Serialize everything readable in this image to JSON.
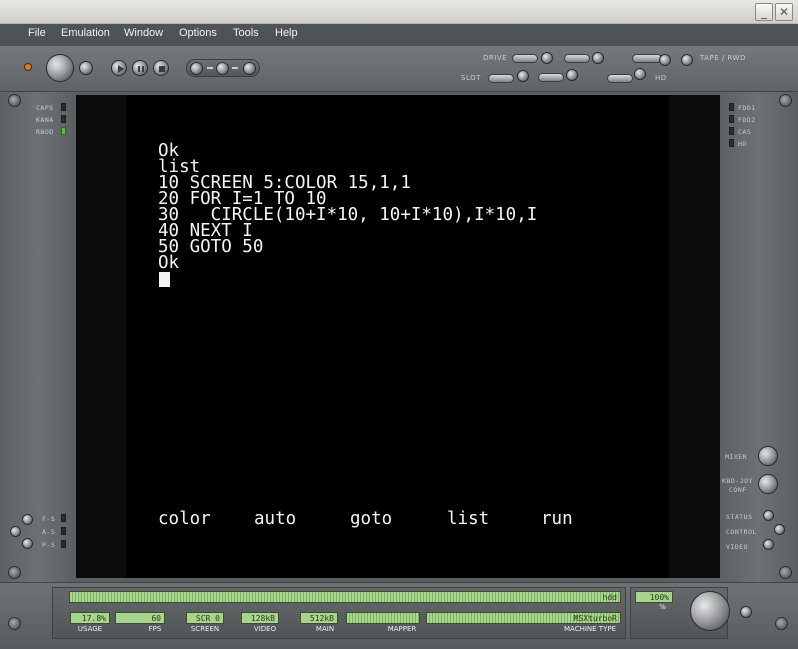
{
  "window": {
    "minimize_glyph": "_",
    "close_glyph": "✕"
  },
  "menu": [
    "File",
    "Emulation",
    "Window",
    "Options",
    "Tools",
    "Help"
  ],
  "toolbar_labels": {
    "drive": "DRIVE",
    "slot": "SLOT",
    "tape": "TAPE / RWD",
    "hd": "HD"
  },
  "left_indicators": [
    "CAPS",
    "KANA",
    "RBOD"
  ],
  "left_bottom_indicators": [
    "F-S",
    "A-S",
    "P-S"
  ],
  "right_indicators": [
    "FDD1",
    "FDD2",
    "CAS",
    "HD"
  ],
  "right_controls": {
    "mixer": "MIXER",
    "kbd_joy_1": "KBD-JOY",
    "kbd_joy_2": "CONF",
    "status": "STATUS",
    "control": "CONTROL",
    "video": "VIDEO"
  },
  "screen": {
    "lines": [
      "Ok",
      "list",
      "10 SCREEN 5:COLOR 15,1,1",
      "20 FOR I=1 TO 10",
      "30   CIRCLE(10+I*10, 10+I*10),I*10,I",
      "40 NEXT I",
      "50 GOTO 50",
      "Ok"
    ],
    "function_keys": [
      "color",
      "auto",
      "goto",
      "list",
      "run"
    ]
  },
  "status": {
    "hdd_label": "hdd",
    "volume": "100%",
    "volume_unit": "%",
    "cells": [
      {
        "value": "17.8%",
        "label": "USAGE"
      },
      {
        "value": "60",
        "label": "FPS"
      },
      {
        "value": "SCR 0",
        "label": "SCREEN"
      },
      {
        "value": "128kB",
        "label": "VIDEO"
      },
      {
        "value": "512kB",
        "label": "MAIN"
      },
      {
        "value": "",
        "label": "MAPPER"
      },
      {
        "value": "MSXturboR",
        "label": "MACHINE TYPE"
      }
    ]
  },
  "colors": {
    "led_on": "#5fbf2a",
    "lcd": "#a6d48a",
    "screen": "#000000",
    "text": "#f4f4f4"
  }
}
